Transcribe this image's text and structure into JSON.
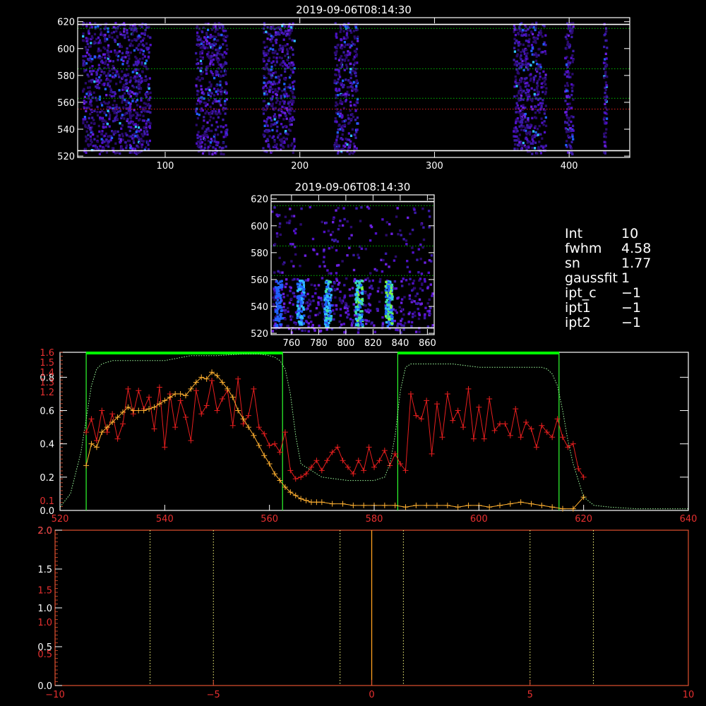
{
  "info_panel": [
    {
      "key": "Int",
      "value": "10"
    },
    {
      "key": "fwhm",
      "value": "4.58"
    },
    {
      "key": "sn",
      "value": "1.77"
    },
    {
      "key": "gaussfit",
      "value": "1"
    },
    {
      "key": "ipt_c",
      "value": "−1"
    },
    {
      "key": "ipt1",
      "value": "−1"
    },
    {
      "key": "ipt2",
      "value": "−1"
    }
  ],
  "chart_data": [
    {
      "type": "heatmap",
      "title": "2019-09-06T08:14:30",
      "xlim": [
        35,
        445
      ],
      "ylim": [
        519,
        623
      ],
      "xticks": [
        100,
        200,
        300,
        400
      ],
      "yticks": [
        520,
        540,
        560,
        580,
        600,
        620
      ],
      "hlines": [
        {
          "y": 618,
          "style": "solid",
          "color": "#ffffff"
        },
        {
          "y": 615,
          "style": "dotted",
          "color": "#00c000"
        },
        {
          "y": 585,
          "style": "dotted",
          "color": "#00c000"
        },
        {
          "y": 563,
          "style": "dotted",
          "color": "#00c000"
        },
        {
          "y": 555,
          "style": "dotted",
          "color": "#e02020"
        },
        {
          "y": 524,
          "style": "solid",
          "color": "#ffffff"
        }
      ],
      "bands": [
        [
          38,
          90
        ],
        [
          122,
          147
        ],
        [
          172,
          197
        ],
        [
          225,
          244
        ],
        [
          358,
          384
        ],
        [
          396,
          404
        ],
        [
          425,
          429
        ]
      ],
      "colors": [
        "#2a0a6e",
        "#3a1aa8",
        "#5010c8",
        "#6a20e0",
        "#2060ff",
        "#30c0ff"
      ]
    },
    {
      "type": "heatmap",
      "title": "2019-09-06T08:14:30",
      "xlim": [
        745,
        865
      ],
      "ylim": [
        519,
        623
      ],
      "xticks": [
        760,
        780,
        800,
        820,
        840,
        860
      ],
      "yticks": [
        520,
        540,
        560,
        580,
        600,
        620
      ],
      "hlines": [
        {
          "y": 618,
          "style": "solid",
          "color": "#ffffff"
        },
        {
          "y": 615,
          "style": "dotted",
          "color": "#00c000"
        },
        {
          "y": 585,
          "style": "dotted",
          "color": "#00c000"
        },
        {
          "y": 563,
          "style": "dotted",
          "color": "#00c000"
        },
        {
          "y": 524,
          "style": "solid",
          "color": "#ffffff"
        }
      ],
      "streaks": [
        750,
        766,
        786,
        809,
        831
      ]
    },
    {
      "type": "line",
      "xlim": [
        520,
        640
      ],
      "xticks": [
        520,
        540,
        560,
        580,
        600,
        620,
        640
      ],
      "left_axis_white": {
        "ylim": [
          0,
          0.95
        ],
        "ticks": [
          0.0,
          0.2,
          0.4,
          0.6,
          0.8
        ]
      },
      "left_axis_red": {
        "ylim": [
          0,
          1.6
        ],
        "ticks": [
          0.1,
          1.2,
          1.3,
          1.4,
          1.5,
          1.6
        ]
      },
      "windows": [
        [
          525,
          562.5
        ],
        [
          584.5,
          615.3
        ]
      ],
      "series": [
        {
          "color": "#e81e1e",
          "x": [
            525,
            526,
            527,
            528,
            529,
            530,
            531,
            532,
            533,
            534,
            535,
            536,
            537,
            538,
            539,
            540,
            541,
            542,
            543,
            544,
            545,
            546,
            547,
            548,
            549,
            550,
            551,
            552,
            553,
            554,
            555,
            556,
            557,
            558,
            559,
            560,
            561,
            562,
            563,
            564,
            565,
            566,
            567,
            568,
            569,
            570,
            571,
            572,
            573,
            574,
            575,
            576,
            577,
            578,
            579,
            580,
            581,
            582,
            583,
            584,
            585,
            586,
            587,
            588,
            589,
            590,
            591,
            592,
            593,
            594,
            595,
            596,
            597,
            598,
            599,
            600,
            601,
            602,
            603,
            604,
            605,
            606,
            607,
            608,
            609,
            610,
            611,
            612,
            613,
            614,
            615,
            616,
            617,
            618,
            619,
            620
          ],
          "y": [
            0.47,
            0.55,
            0.42,
            0.6,
            0.47,
            0.58,
            0.43,
            0.52,
            0.73,
            0.58,
            0.72,
            0.61,
            0.68,
            0.49,
            0.74,
            0.38,
            0.7,
            0.5,
            0.66,
            0.56,
            0.42,
            0.72,
            0.58,
            0.63,
            0.78,
            0.6,
            0.67,
            0.72,
            0.51,
            0.79,
            0.52,
            0.57,
            0.73,
            0.5,
            0.46,
            0.39,
            0.4,
            0.35,
            0.47,
            0.24,
            0.19,
            0.2,
            0.22,
            0.26,
            0.3,
            0.24,
            0.3,
            0.35,
            0.38,
            0.3,
            0.26,
            0.22,
            0.3,
            0.24,
            0.38,
            0.26,
            0.3,
            0.36,
            0.27,
            0.34,
            0.28,
            0.24,
            0.7,
            0.57,
            0.55,
            0.66,
            0.34,
            0.64,
            0.44,
            0.7,
            0.54,
            0.6,
            0.5,
            0.73,
            0.43,
            0.62,
            0.43,
            0.67,
            0.48,
            0.52,
            0.52,
            0.45,
            0.61,
            0.44,
            0.53,
            0.49,
            0.38,
            0.51,
            0.47,
            0.44,
            0.55,
            0.44,
            0.38,
            0.4,
            0.25,
            0.2
          ]
        },
        {
          "color": "#ffb030",
          "x": [
            525,
            526,
            527,
            528,
            529,
            530,
            531,
            532,
            533,
            534,
            535,
            536,
            537,
            538,
            539,
            540,
            541,
            542,
            543,
            544,
            545,
            546,
            547,
            548,
            549,
            550,
            551,
            552,
            553,
            554,
            555,
            556,
            557,
            558,
            559,
            560,
            561,
            562,
            563,
            564,
            565,
            566,
            567,
            568,
            569,
            570,
            572,
            574,
            576,
            578,
            580,
            582,
            584,
            586,
            588,
            590,
            592,
            594,
            596,
            598,
            600,
            602,
            604,
            606,
            608,
            610,
            612,
            614,
            616,
            618,
            620
          ],
          "y": [
            0.27,
            0.4,
            0.38,
            0.47,
            0.5,
            0.53,
            0.56,
            0.59,
            0.62,
            0.6,
            0.6,
            0.6,
            0.61,
            0.62,
            0.64,
            0.66,
            0.68,
            0.7,
            0.7,
            0.69,
            0.73,
            0.77,
            0.8,
            0.79,
            0.83,
            0.81,
            0.77,
            0.73,
            0.68,
            0.6,
            0.55,
            0.5,
            0.45,
            0.39,
            0.33,
            0.28,
            0.22,
            0.18,
            0.14,
            0.11,
            0.09,
            0.07,
            0.06,
            0.05,
            0.05,
            0.05,
            0.04,
            0.04,
            0.03,
            0.03,
            0.03,
            0.03,
            0.03,
            0.02,
            0.03,
            0.03,
            0.03,
            0.03,
            0.02,
            0.03,
            0.03,
            0.02,
            0.03,
            0.04,
            0.05,
            0.04,
            0.03,
            0.02,
            0.01,
            0.01,
            0.08
          ]
        },
        {
          "color": "#a0ffa0",
          "style": "dotted",
          "x": [
            520,
            522,
            524,
            525,
            526,
            527,
            528,
            530,
            533,
            536,
            540,
            545,
            550,
            555,
            558,
            560,
            561,
            562,
            563,
            564,
            565,
            566,
            570,
            575,
            580,
            582,
            583,
            584,
            585,
            586,
            587,
            588,
            590,
            595,
            600,
            605,
            610,
            612,
            613,
            614,
            615,
            616,
            617,
            618,
            619,
            620,
            622,
            625,
            630,
            635,
            640
          ],
          "y": [
            0.02,
            0.1,
            0.35,
            0.55,
            0.75,
            0.85,
            0.88,
            0.9,
            0.9,
            0.9,
            0.9,
            0.93,
            0.93,
            0.94,
            0.94,
            0.93,
            0.92,
            0.9,
            0.85,
            0.7,
            0.45,
            0.28,
            0.2,
            0.18,
            0.18,
            0.2,
            0.28,
            0.45,
            0.72,
            0.86,
            0.88,
            0.88,
            0.88,
            0.88,
            0.86,
            0.86,
            0.86,
            0.86,
            0.85,
            0.82,
            0.75,
            0.6,
            0.42,
            0.28,
            0.18,
            0.08,
            0.03,
            0.02,
            0.01,
            0.01,
            0.01
          ]
        }
      ]
    },
    {
      "type": "line",
      "xlim": [
        -10,
        10
      ],
      "xticks": [
        -10,
        -5,
        0,
        5,
        10
      ],
      "left_axis_white": {
        "ylim": [
          0,
          2.0
        ],
        "ticks": [
          0.0,
          0.5,
          1.0,
          1.5,
          2.0
        ]
      },
      "left_axis_red": {
        "ticks": [
          0.5,
          1.0,
          1.5,
          2.0
        ]
      },
      "vlines_dotted": [
        -7,
        -5,
        -1,
        1,
        5,
        7
      ],
      "vline_solid": 0
    }
  ]
}
